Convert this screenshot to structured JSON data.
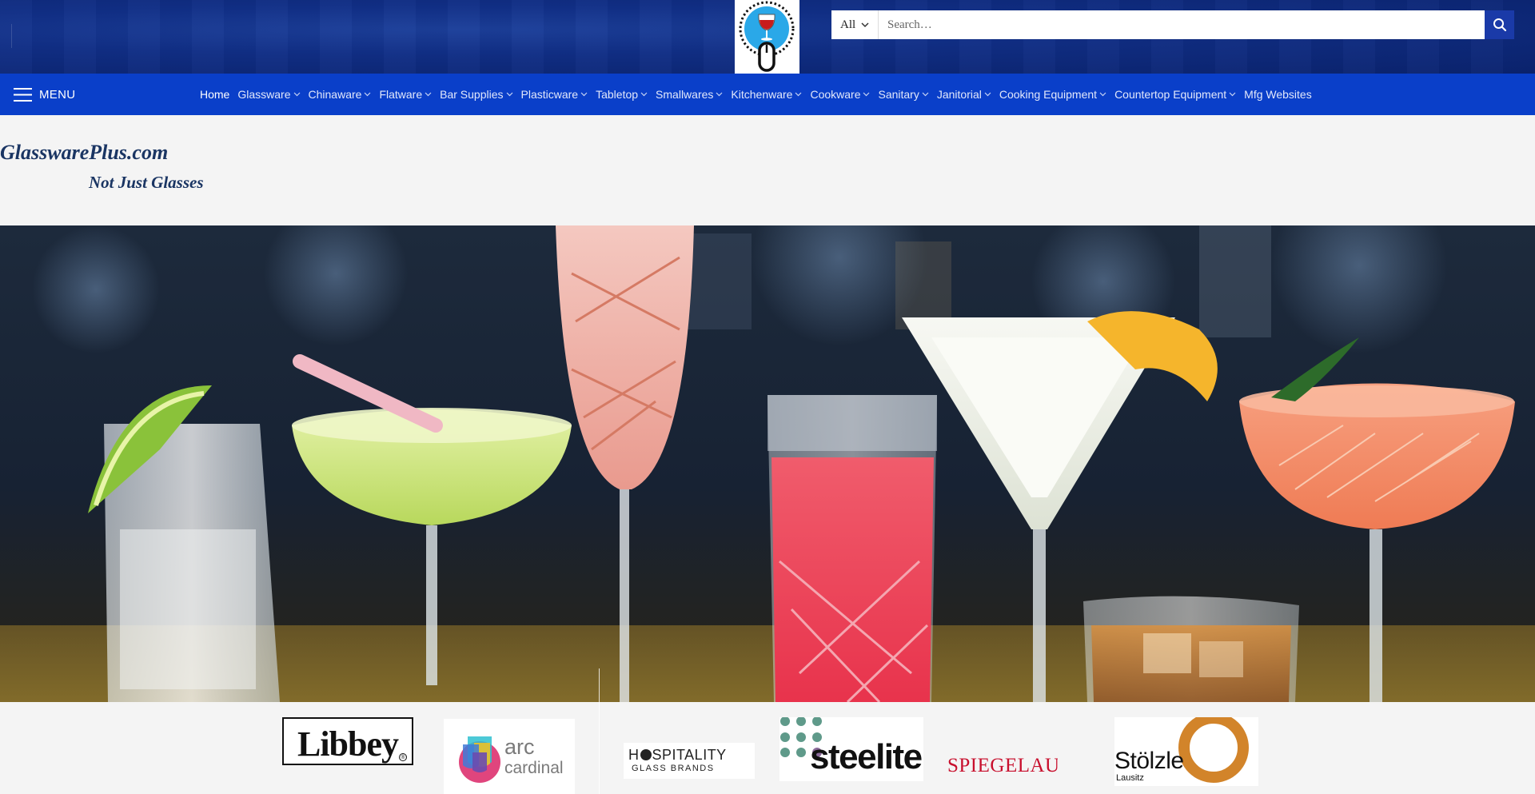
{
  "header": {
    "search": {
      "category_label": "All",
      "placeholder": "Search…"
    }
  },
  "nav": {
    "menu_label": "MENU",
    "items": [
      {
        "label": "Home",
        "active": true,
        "has_dropdown": false
      },
      {
        "label": "Glassware",
        "has_dropdown": true
      },
      {
        "label": "Chinaware",
        "has_dropdown": true
      },
      {
        "label": "Flatware",
        "has_dropdown": true
      },
      {
        "label": "Bar Supplies",
        "has_dropdown": true
      },
      {
        "label": "Plasticware",
        "has_dropdown": true
      },
      {
        "label": "Tabletop",
        "has_dropdown": true
      },
      {
        "label": "Smallwares",
        "has_dropdown": true
      },
      {
        "label": "Kitchenware",
        "has_dropdown": true
      },
      {
        "label": "Cookware",
        "has_dropdown": true
      },
      {
        "label": "Sanitary",
        "has_dropdown": true
      },
      {
        "label": "Janitorial",
        "has_dropdown": true
      },
      {
        "label": "Cooking Equipment",
        "has_dropdown": true
      },
      {
        "label": "Countertop Equipment",
        "has_dropdown": true
      },
      {
        "label": "Mfg Websites",
        "has_dropdown": false
      }
    ]
  },
  "site": {
    "title": "GlasswarePlus.com",
    "tagline": "Not Just Glasses"
  },
  "brands": {
    "libbey": "Libbey",
    "arc_line1": "arc",
    "arc_line2": "cardinal",
    "hospitality_line1": "H",
    "hospitality_line1b": "SPITALITY",
    "hospitality_line2": "GLASS BRANDS",
    "steelite": "steelite",
    "spiegelau": "SPIEGELAU",
    "stolzle": "Stölzle",
    "stolzle_sub": "Lausitz"
  },
  "colors": {
    "header_bg": "#102e86",
    "nav_bg": "#0a3fc9",
    "search_btn": "#1a3aa8",
    "brand_text": "#1a3563"
  }
}
